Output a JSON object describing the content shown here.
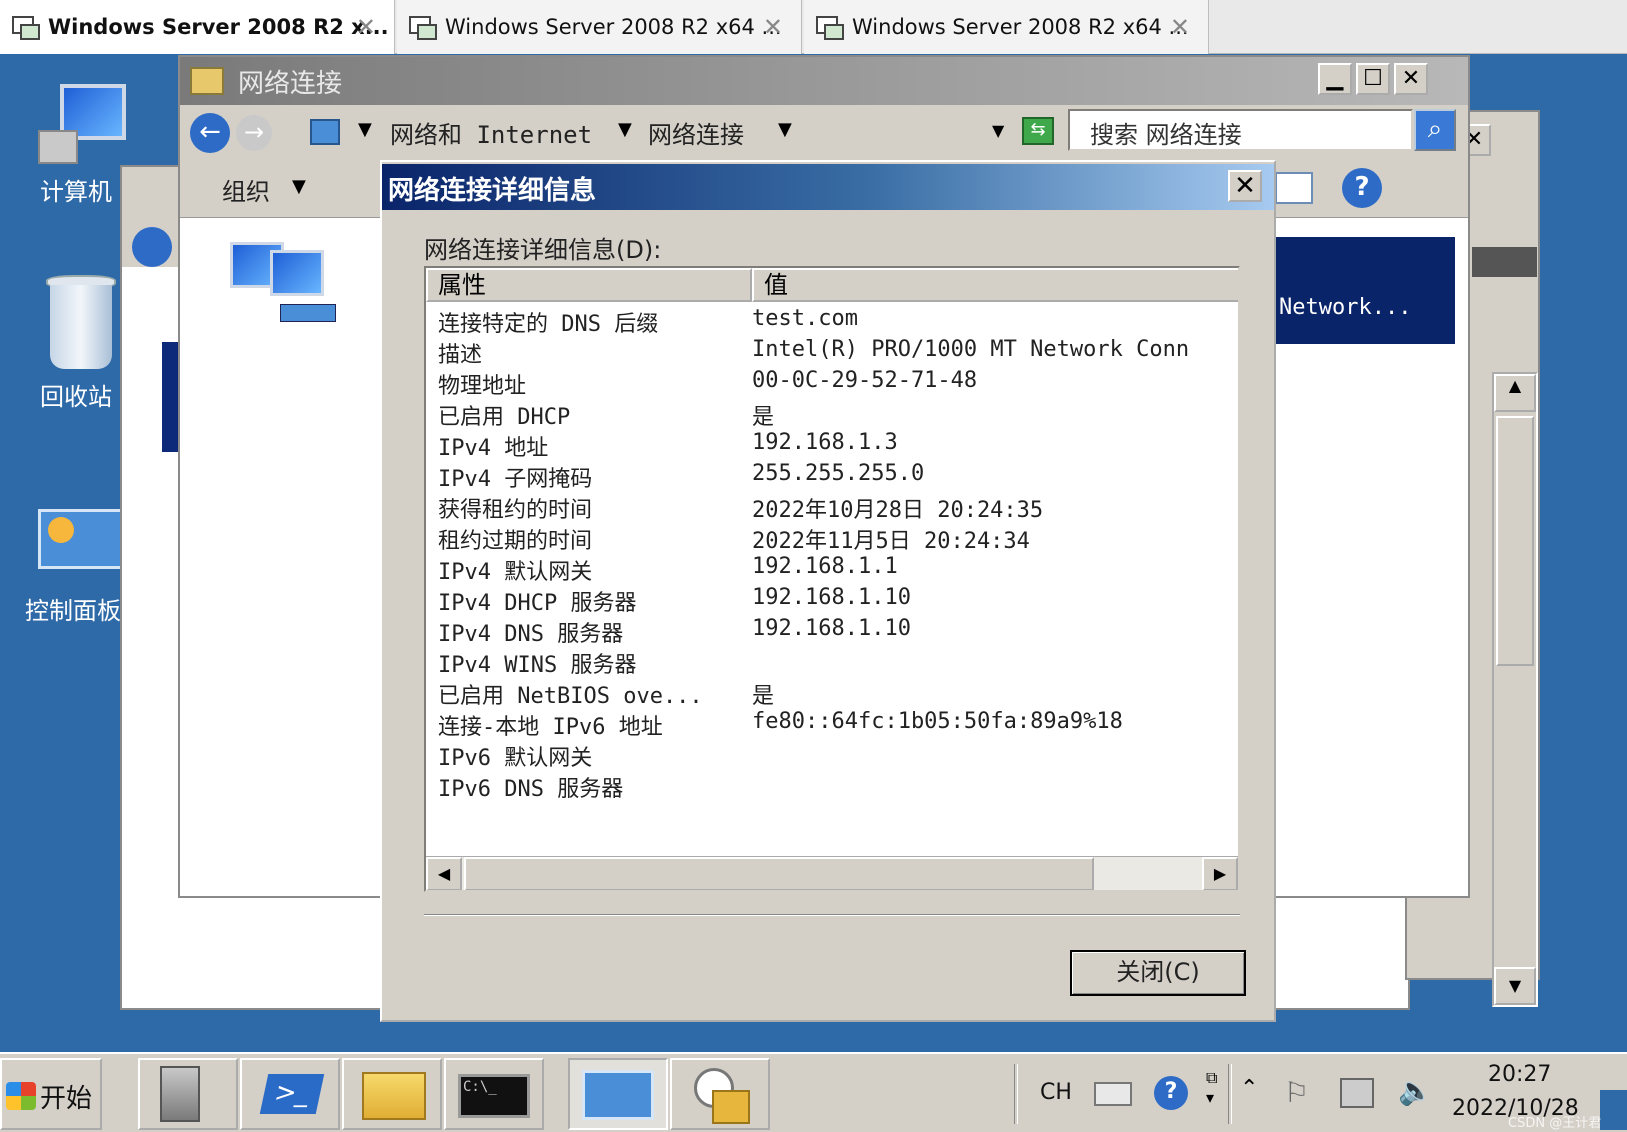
{
  "vm_tabs": [
    {
      "label": "Windows Server 2008 R2 x..."
    },
    {
      "label": "Windows Server 2008 R2 x64 ..."
    },
    {
      "label": "Windows Server 2008 R2 x64 ..."
    }
  ],
  "desktop": {
    "icons": [
      {
        "label": "计算机"
      },
      {
        "label": "回收站"
      },
      {
        "label": "控制面板"
      }
    ]
  },
  "net_window": {
    "title": "网络连接",
    "breadcrumb": {
      "part1": "网络和 Internet",
      "part2": "网络连接"
    },
    "search_placeholder": "搜索 网络连接",
    "organize": "组织",
    "adapter_name_fragment": "Network..."
  },
  "dialog": {
    "title": "网络连接详细信息",
    "group_label": "网络连接详细信息(D):",
    "col_property": "属性",
    "col_value": "值",
    "rows": [
      {
        "k": "连接特定的 DNS 后缀",
        "v": "test.com"
      },
      {
        "k": "描述",
        "v": "Intel(R) PRO/1000 MT Network Conn"
      },
      {
        "k": "物理地址",
        "v": "00-0C-29-52-71-48"
      },
      {
        "k": "已启用 DHCP",
        "v": "是"
      },
      {
        "k": "IPv4 地址",
        "v": "192.168.1.3"
      },
      {
        "k": "IPv4 子网掩码",
        "v": "255.255.255.0"
      },
      {
        "k": "获得租约的时间",
        "v": "2022年10月28日 20:24:35"
      },
      {
        "k": "租约过期的时间",
        "v": "2022年11月5日 20:24:34"
      },
      {
        "k": "IPv4 默认网关",
        "v": "192.168.1.1"
      },
      {
        "k": "IPv4 DHCP 服务器",
        "v": "192.168.1.10"
      },
      {
        "k": "IPv4 DNS 服务器",
        "v": "192.168.1.10"
      },
      {
        "k": "IPv4 WINS 服务器",
        "v": ""
      },
      {
        "k": "已启用 NetBIOS ove...",
        "v": "是"
      },
      {
        "k": "连接-本地 IPv6 地址",
        "v": "fe80::64fc:1b05:50fa:89a9%18"
      },
      {
        "k": "IPv6 默认网关",
        "v": ""
      },
      {
        "k": "IPv6 DNS 服务器",
        "v": ""
      }
    ],
    "close_button": "关闭(C)"
  },
  "taskbar": {
    "start": "开始",
    "lang": "CH",
    "time": "20:27",
    "date": "2022/10/28"
  },
  "watermark": "CSDN @王计君",
  "colors": {
    "desktop": "#2f6aa8",
    "dialog_title": "#0a246a",
    "selection": "#0a246a"
  }
}
